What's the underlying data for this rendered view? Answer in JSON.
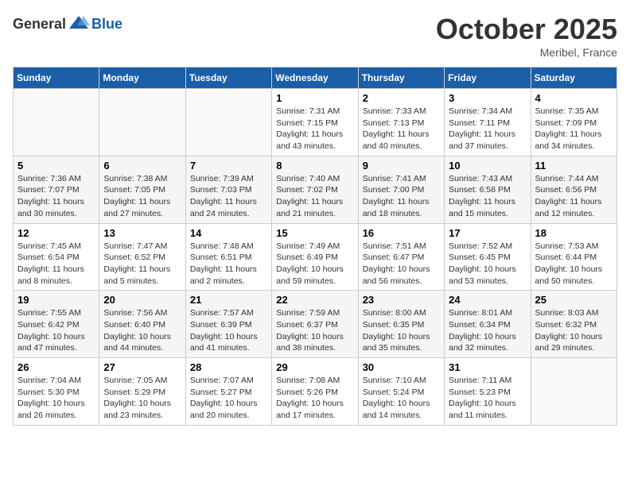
{
  "header": {
    "logo_general": "General",
    "logo_blue": "Blue",
    "month": "October 2025",
    "location": "Meribel, France"
  },
  "weekdays": [
    "Sunday",
    "Monday",
    "Tuesday",
    "Wednesday",
    "Thursday",
    "Friday",
    "Saturday"
  ],
  "weeks": [
    [
      {
        "day": "",
        "info": ""
      },
      {
        "day": "",
        "info": ""
      },
      {
        "day": "",
        "info": ""
      },
      {
        "day": "1",
        "info": "Sunrise: 7:31 AM\nSunset: 7:15 PM\nDaylight: 11 hours and 43 minutes."
      },
      {
        "day": "2",
        "info": "Sunrise: 7:33 AM\nSunset: 7:13 PM\nDaylight: 11 hours and 40 minutes."
      },
      {
        "day": "3",
        "info": "Sunrise: 7:34 AM\nSunset: 7:11 PM\nDaylight: 11 hours and 37 minutes."
      },
      {
        "day": "4",
        "info": "Sunrise: 7:35 AM\nSunset: 7:09 PM\nDaylight: 11 hours and 34 minutes."
      }
    ],
    [
      {
        "day": "5",
        "info": "Sunrise: 7:36 AM\nSunset: 7:07 PM\nDaylight: 11 hours and 30 minutes."
      },
      {
        "day": "6",
        "info": "Sunrise: 7:38 AM\nSunset: 7:05 PM\nDaylight: 11 hours and 27 minutes."
      },
      {
        "day": "7",
        "info": "Sunrise: 7:39 AM\nSunset: 7:03 PM\nDaylight: 11 hours and 24 minutes."
      },
      {
        "day": "8",
        "info": "Sunrise: 7:40 AM\nSunset: 7:02 PM\nDaylight: 11 hours and 21 minutes."
      },
      {
        "day": "9",
        "info": "Sunrise: 7:41 AM\nSunset: 7:00 PM\nDaylight: 11 hours and 18 minutes."
      },
      {
        "day": "10",
        "info": "Sunrise: 7:43 AM\nSunset: 6:58 PM\nDaylight: 11 hours and 15 minutes."
      },
      {
        "day": "11",
        "info": "Sunrise: 7:44 AM\nSunset: 6:56 PM\nDaylight: 11 hours and 12 minutes."
      }
    ],
    [
      {
        "day": "12",
        "info": "Sunrise: 7:45 AM\nSunset: 6:54 PM\nDaylight: 11 hours and 8 minutes."
      },
      {
        "day": "13",
        "info": "Sunrise: 7:47 AM\nSunset: 6:52 PM\nDaylight: 11 hours and 5 minutes."
      },
      {
        "day": "14",
        "info": "Sunrise: 7:48 AM\nSunset: 6:51 PM\nDaylight: 11 hours and 2 minutes."
      },
      {
        "day": "15",
        "info": "Sunrise: 7:49 AM\nSunset: 6:49 PM\nDaylight: 10 hours and 59 minutes."
      },
      {
        "day": "16",
        "info": "Sunrise: 7:51 AM\nSunset: 6:47 PM\nDaylight: 10 hours and 56 minutes."
      },
      {
        "day": "17",
        "info": "Sunrise: 7:52 AM\nSunset: 6:45 PM\nDaylight: 10 hours and 53 minutes."
      },
      {
        "day": "18",
        "info": "Sunrise: 7:53 AM\nSunset: 6:44 PM\nDaylight: 10 hours and 50 minutes."
      }
    ],
    [
      {
        "day": "19",
        "info": "Sunrise: 7:55 AM\nSunset: 6:42 PM\nDaylight: 10 hours and 47 minutes."
      },
      {
        "day": "20",
        "info": "Sunrise: 7:56 AM\nSunset: 6:40 PM\nDaylight: 10 hours and 44 minutes."
      },
      {
        "day": "21",
        "info": "Sunrise: 7:57 AM\nSunset: 6:39 PM\nDaylight: 10 hours and 41 minutes."
      },
      {
        "day": "22",
        "info": "Sunrise: 7:59 AM\nSunset: 6:37 PM\nDaylight: 10 hours and 38 minutes."
      },
      {
        "day": "23",
        "info": "Sunrise: 8:00 AM\nSunset: 6:35 PM\nDaylight: 10 hours and 35 minutes."
      },
      {
        "day": "24",
        "info": "Sunrise: 8:01 AM\nSunset: 6:34 PM\nDaylight: 10 hours and 32 minutes."
      },
      {
        "day": "25",
        "info": "Sunrise: 8:03 AM\nSunset: 6:32 PM\nDaylight: 10 hours and 29 minutes."
      }
    ],
    [
      {
        "day": "26",
        "info": "Sunrise: 7:04 AM\nSunset: 5:30 PM\nDaylight: 10 hours and 26 minutes."
      },
      {
        "day": "27",
        "info": "Sunrise: 7:05 AM\nSunset: 5:29 PM\nDaylight: 10 hours and 23 minutes."
      },
      {
        "day": "28",
        "info": "Sunrise: 7:07 AM\nSunset: 5:27 PM\nDaylight: 10 hours and 20 minutes."
      },
      {
        "day": "29",
        "info": "Sunrise: 7:08 AM\nSunset: 5:26 PM\nDaylight: 10 hours and 17 minutes."
      },
      {
        "day": "30",
        "info": "Sunrise: 7:10 AM\nSunset: 5:24 PM\nDaylight: 10 hours and 14 minutes."
      },
      {
        "day": "31",
        "info": "Sunrise: 7:11 AM\nSunset: 5:23 PM\nDaylight: 10 hours and 11 minutes."
      },
      {
        "day": "",
        "info": ""
      }
    ]
  ]
}
